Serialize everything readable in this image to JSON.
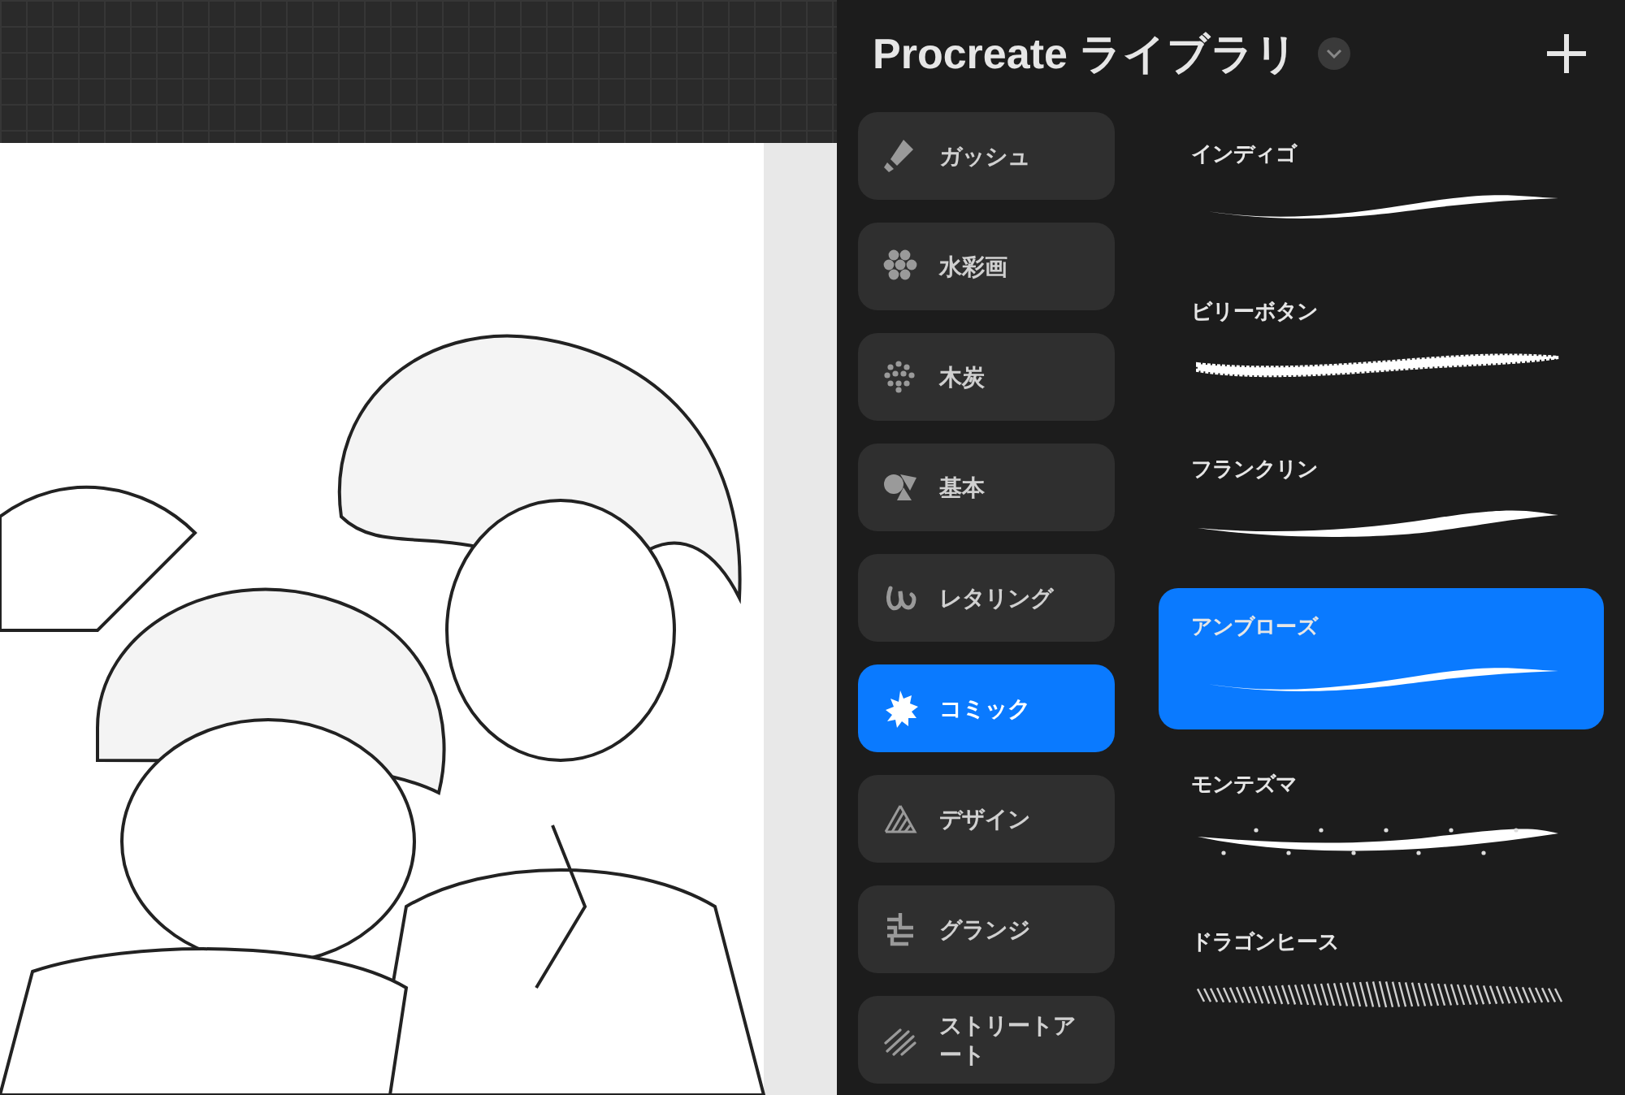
{
  "library": {
    "title": "Procreate ライブラリ"
  },
  "categories": [
    {
      "label": "ガッシュ",
      "kind": "tube",
      "selected": false
    },
    {
      "label": "水彩画",
      "kind": "dots",
      "selected": false
    },
    {
      "label": "木炭",
      "kind": "charcoal",
      "selected": false
    },
    {
      "label": "基本",
      "kind": "shapes",
      "selected": false
    },
    {
      "label": "レタリング",
      "kind": "lettering",
      "selected": false
    },
    {
      "label": "コミック",
      "kind": "burst",
      "selected": true
    },
    {
      "label": "デザイン",
      "kind": "design",
      "selected": false
    },
    {
      "label": "グランジ",
      "kind": "grunge",
      "selected": false
    },
    {
      "label": "ストリートアート",
      "kind": "streak",
      "selected": false
    }
  ],
  "brushes": [
    {
      "name": "インディゴ",
      "kind": "thin",
      "selected": false
    },
    {
      "name": "ビリーボタン",
      "kind": "rough",
      "selected": false
    },
    {
      "name": "フランクリン",
      "kind": "taper",
      "selected": false
    },
    {
      "name": "アンブローズ",
      "kind": "thin",
      "selected": true
    },
    {
      "name": "モンテズマ",
      "kind": "spatter",
      "selected": false
    },
    {
      "name": "ドラゴンヒース",
      "kind": "hatch",
      "selected": false
    }
  ]
}
